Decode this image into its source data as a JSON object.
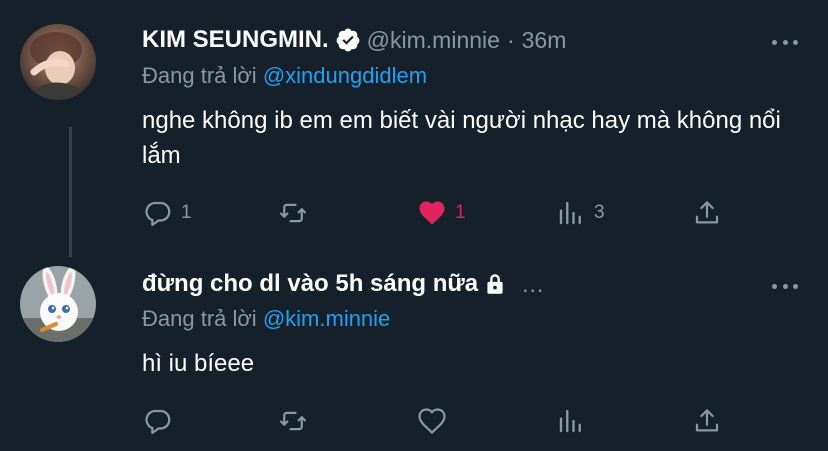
{
  "tweets": [
    {
      "author_name": "KIM SEUNGMIN.",
      "verified": true,
      "handle": "@kim.minnie",
      "separator": "·",
      "time": "36m",
      "replying_prefix": "Đang trả lời",
      "replying_to": "@xindungdidlem",
      "text": "nghe không ib em em biết vài người nhạc hay mà không nổi lắm",
      "reply_count": "1",
      "retweet_count": "",
      "like_count": "1",
      "liked": true,
      "views_count": "3"
    },
    {
      "author_name": "đừng cho dl vào 5h sáng nữa",
      "protected": true,
      "ellipsis": "...",
      "replying_prefix": "Đang trả lời",
      "replying_to": "@kim.minnie",
      "text": "hì iu bíeee",
      "reply_count": "",
      "retweet_count": "",
      "like_count": "",
      "liked": false,
      "views_count": ""
    }
  ],
  "icons": {
    "reply": "reply-icon",
    "retweet": "retweet-icon",
    "like": "heart-icon",
    "views": "views-icon",
    "share": "share-icon",
    "more": "more-icon",
    "verified": "verified-badge-icon",
    "lock": "lock-icon"
  },
  "colors": {
    "background": "#15202b",
    "text": "#ffffff",
    "muted": "#8899a6",
    "accent": "#1da1f2",
    "like": "#e0245e",
    "thread_line": "#38444d"
  }
}
